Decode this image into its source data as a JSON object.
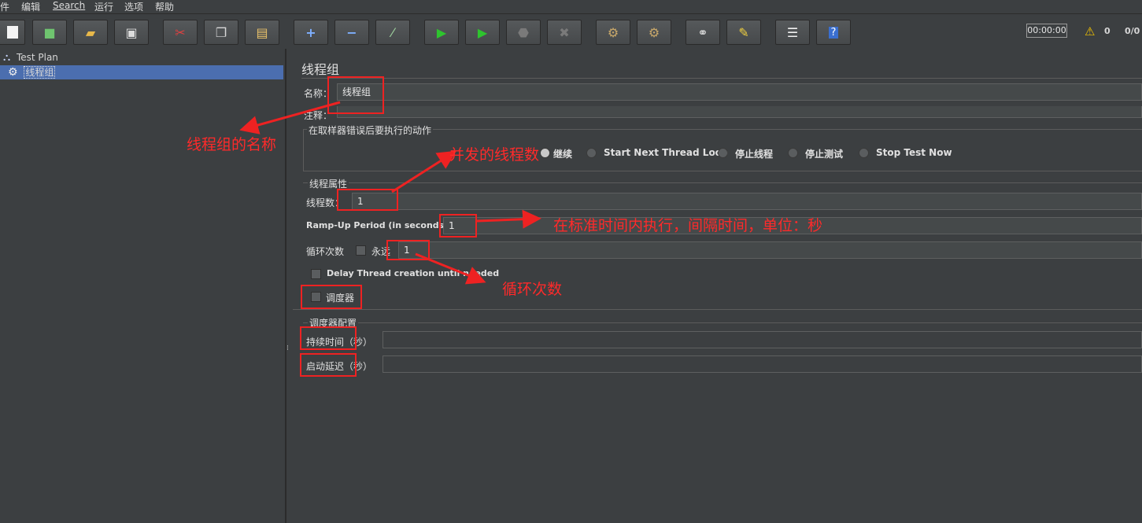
{
  "menu": [
    "件",
    "编辑",
    "Search",
    "运行",
    "选项",
    "帮助"
  ],
  "toolbar": {
    "icons": [
      "new-icon",
      "templates-icon",
      "open-icon",
      "save-icon",
      "cut-icon",
      "copy-icon",
      "paste-icon",
      "expand-icon",
      "collapse-icon",
      "toggle-icon",
      "start-icon",
      "start-no-pauses-icon",
      "stop-icon",
      "shutdown-icon",
      "clear-icon",
      "clear-all-icon",
      "search-icon",
      "reset-search-icon",
      "function-helper-icon",
      "help-icon"
    ],
    "timer": "00:00:00",
    "warning_count": "0",
    "thread_ratio": "0/0"
  },
  "tree": {
    "root_label": "Test Plan",
    "child_label": "线程组"
  },
  "panel": {
    "title": "线程组",
    "name_label": "名称：",
    "name_value": "线程组",
    "comment_label": "注释：",
    "sampler_error_title": "在取样器错误后要执行的动作",
    "error_options": [
      "继续",
      "Start Next Thread Loop",
      "停止线程",
      "停止测试",
      "Stop Test Now"
    ],
    "thread_props_title": "线程属性",
    "threads_label": "线程数：",
    "threads_value": "1",
    "rampup_label": "Ramp-Up Period (in seconds):",
    "rampup_value": "1",
    "loop_label": "循环次数",
    "forever_label": "永远",
    "loop_value": "1",
    "delay_label": "Delay Thread creation until needed",
    "scheduler_label": "调度器",
    "scheduler_config_title": "调度器配置",
    "duration_label": "持续时间（秒）",
    "startup_delay_label": "启动延迟（秒）"
  },
  "annotations": {
    "name_note": "线程组的名称",
    "threads_note": "并发的线程数",
    "rampup_note": "在标准时间内执行，间隔时间，单位：秒",
    "loop_note": "循环次数"
  },
  "colors": {
    "background": "#3c3f41",
    "selection": "#4b6eaf",
    "annotation": "#ee2222"
  }
}
